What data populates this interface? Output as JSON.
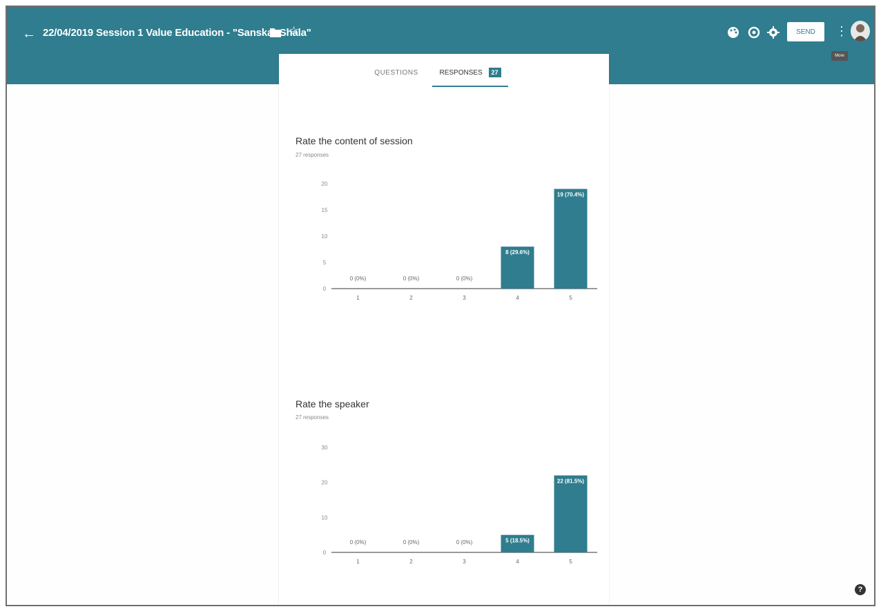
{
  "header": {
    "title": "22/04/2019 Session 1 Value Education - \"Sanskar Shala\"",
    "back_icon": "arrow-left-icon",
    "icons": [
      "folder-icon",
      "star-icon",
      "palette-icon",
      "preview-eye-icon",
      "gear-icon",
      "more-vert-icon"
    ],
    "send_label": "SEND",
    "tooltip": "More"
  },
  "tabs": {
    "questions": "QUESTIONS",
    "responses": "RESPONSES",
    "responses_count": "27"
  },
  "colors": {
    "header": "#2f7d8e",
    "bar": "#2f7d8e",
    "axis": "#333333"
  },
  "questions": [
    {
      "title": "Rate the content of session",
      "subtitle": "27 responses"
    },
    {
      "title": "Rate the speaker",
      "subtitle": "27 responses"
    }
  ],
  "chart_data": [
    {
      "type": "bar",
      "title": "Rate the content of session",
      "categories": [
        "1",
        "2",
        "3",
        "4",
        "5"
      ],
      "values": [
        0,
        0,
        0,
        8,
        19
      ],
      "data_labels": [
        "0 (0%)",
        "0 (0%)",
        "0 (0%)",
        "8 (29.6%)",
        "19 (70.4%)"
      ],
      "yticks": [
        0,
        5,
        10,
        15,
        20
      ],
      "ylim": [
        0,
        20
      ],
      "grid": false
    },
    {
      "type": "bar",
      "title": "Rate the speaker",
      "categories": [
        "1",
        "2",
        "3",
        "4",
        "5"
      ],
      "values": [
        0,
        0,
        0,
        5,
        22
      ],
      "data_labels": [
        "0 (0%)",
        "0 (0%)",
        "0 (0%)",
        "5 (18.5%)",
        "22 (81.5%)"
      ],
      "yticks": [
        0,
        10,
        20,
        30
      ],
      "ylim": [
        0,
        30
      ],
      "grid": false
    }
  ],
  "help_icon": "help-circle-icon"
}
